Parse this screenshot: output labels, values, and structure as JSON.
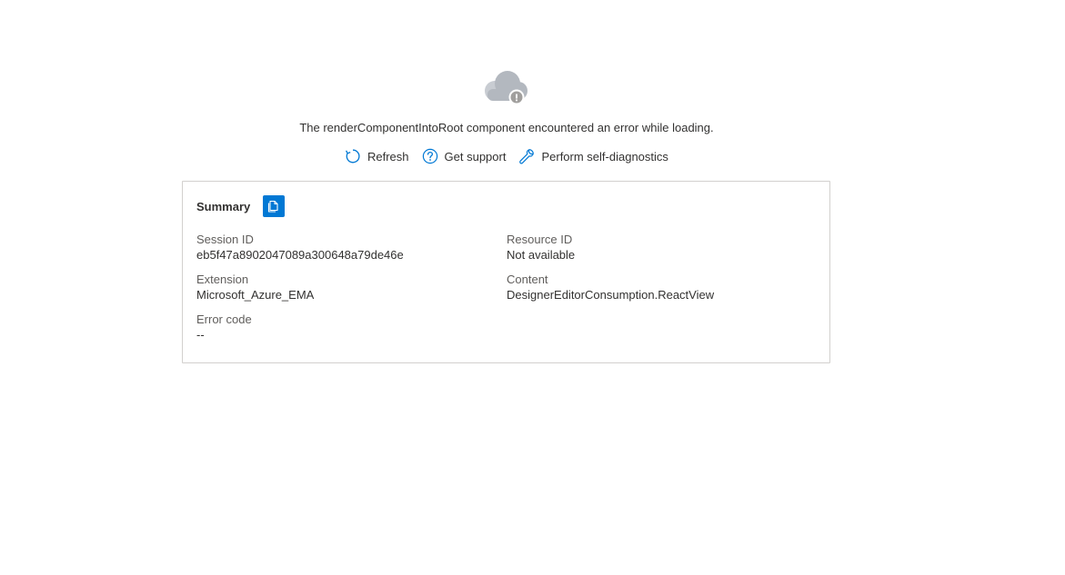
{
  "error": {
    "message": "The renderComponentIntoRoot component encountered an error while loading."
  },
  "actions": {
    "refresh_label": "Refresh",
    "support_label": "Get support",
    "diagnostics_label": "Perform self-diagnostics"
  },
  "summary": {
    "title": "Summary",
    "fields": {
      "session_id_label": "Session ID",
      "session_id_value": "eb5f47a8902047089a300648a79de46e",
      "resource_id_label": "Resource ID",
      "resource_id_value": "Not available",
      "extension_label": "Extension",
      "extension_value": "Microsoft_Azure_EMA",
      "content_label": "Content",
      "content_value": "DesignerEditorConsumption.ReactView",
      "error_code_label": "Error code",
      "error_code_value": "--"
    }
  },
  "icons": {
    "cloud": "cloud-error-icon",
    "refresh": "refresh-icon",
    "support": "question-circle-icon",
    "diagnostics": "wrench-icon",
    "copy": "copy-icon"
  },
  "colors": {
    "accent": "#0078d4",
    "cloud": "#b3b8bf",
    "text": "#323130",
    "label": "#605e5c",
    "border": "#d2d0ce"
  }
}
